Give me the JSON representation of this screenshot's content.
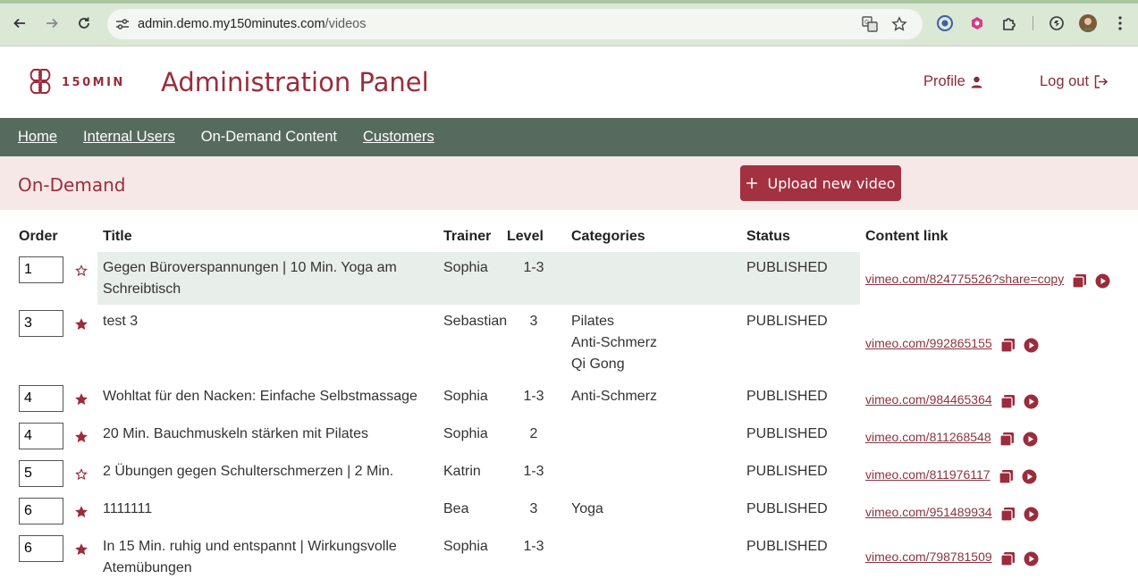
{
  "browser": {
    "url_host": "admin.demo.my150minutes.com",
    "url_path": "/videos"
  },
  "header": {
    "logo_text": "150MIN",
    "title": "Administration Panel",
    "profile_label": "Profile",
    "logout_label": "Log out"
  },
  "nav": {
    "items": [
      {
        "label": "Home"
      },
      {
        "label": "Internal Users"
      },
      {
        "label": "On-Demand Content"
      },
      {
        "label": "Customers"
      }
    ]
  },
  "section": {
    "title": "On-Demand",
    "upload_label": "Upload new video"
  },
  "table": {
    "columns": [
      "Order",
      "Title",
      "Trainer",
      "Level",
      "Categories",
      "Status",
      "Content link"
    ],
    "rows": [
      {
        "order": "1",
        "featured": false,
        "title_lines": [
          "Gegen Büroverspannungen | 10 Min. Yoga am",
          "Schreibtisch"
        ],
        "trainer": "Sophia",
        "level": "1-3",
        "categories": [],
        "status": "PUBLISHED",
        "link": "vimeo.com/824775526?share=copy"
      },
      {
        "order": "3",
        "featured": true,
        "title_lines": [
          "test 3"
        ],
        "trainer": "Sebastian",
        "level": "3",
        "categories": [
          "Pilates",
          "Anti-Schmerz",
          "Qi Gong"
        ],
        "status": "PUBLISHED",
        "link": "vimeo.com/992865155"
      },
      {
        "order": "4",
        "featured": true,
        "title_lines": [
          "Wohltat für den Nacken: Einfache Selbstmassage"
        ],
        "trainer": "Sophia",
        "level": "1-3",
        "categories": [
          "Anti-Schmerz"
        ],
        "status": "PUBLISHED",
        "link": "vimeo.com/984465364"
      },
      {
        "order": "4",
        "featured": true,
        "title_lines": [
          "20 Min. Bauchmuskeln stärken mit Pilates"
        ],
        "trainer": "Sophia",
        "level": "2",
        "categories": [],
        "status": "PUBLISHED",
        "link": "vimeo.com/811268548"
      },
      {
        "order": "5",
        "featured": false,
        "title_lines": [
          "2 Übungen gegen Schulterschmerzen | 2 Min."
        ],
        "trainer": "Katrin",
        "level": "1-3",
        "categories": [],
        "status": "PUBLISHED",
        "link": "vimeo.com/811976117"
      },
      {
        "order": "6",
        "featured": true,
        "title_lines": [
          "1111111"
        ],
        "trainer": "Bea",
        "level": "3",
        "categories": [
          "Yoga"
        ],
        "status": "PUBLISHED",
        "link": "vimeo.com/951489934"
      },
      {
        "order": "6",
        "featured": true,
        "title_lines": [
          "In 15 Min. ruhig und entspannt | Wirkungsvolle",
          "Atemübungen"
        ],
        "trainer": "Sophia",
        "level": "1-3",
        "categories": [],
        "status": "PUBLISHED",
        "link": "vimeo.com/798781509"
      }
    ]
  },
  "colors": {
    "brand": "#9b2c3b",
    "nav_bg": "#566a5d",
    "band_bg": "#f7e8e8",
    "button_bg": "#a3313f"
  }
}
